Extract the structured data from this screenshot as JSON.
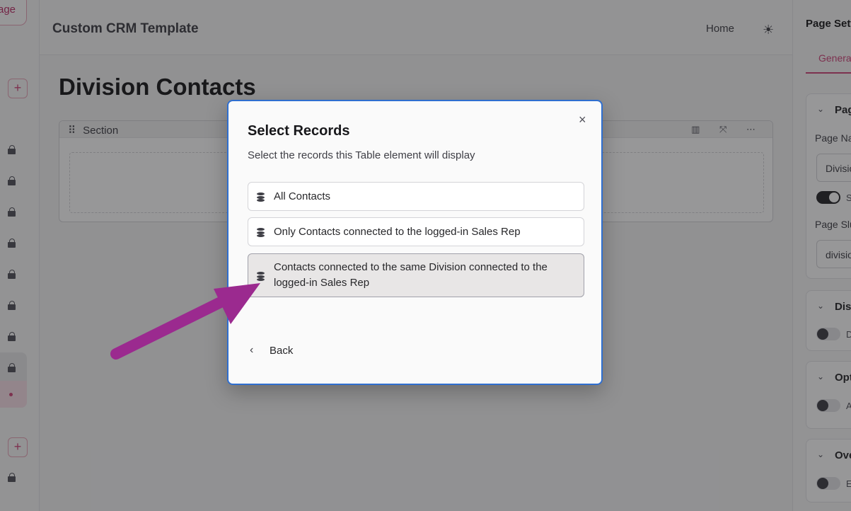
{
  "left_rail": {
    "page_chip_text": "age",
    "plus_label": "+"
  },
  "topbar": {
    "app_title": "Custom CRM Template",
    "home_label": "Home",
    "theme_icon": "☀"
  },
  "main": {
    "page_heading": "Division Contacts",
    "section_label": "Section",
    "section_drag_icon": "⠿",
    "section_tools": "▥ ⤧ ⋯"
  },
  "right_panel": {
    "title": "Page Settings",
    "tab_general": "General",
    "card1_title": "Page",
    "page_name_label": "Page Name",
    "page_name_value": "Division Contacts",
    "toggle1_text": "S",
    "page_slug_label": "Page Slug",
    "page_slug_value": "division-contacts",
    "card2_title": "Display",
    "card2_toggle_text": "D",
    "card3_title": "Options",
    "card3_toggle_text": "A",
    "card4_title": "Overview",
    "card4_toggle_text": "E",
    "chevron": "⌄"
  },
  "modal": {
    "close_icon": "×",
    "title": "Select Records",
    "description": "Select the records this Table element will display",
    "options": [
      {
        "label": "All Contacts",
        "selected": false
      },
      {
        "label": "Only Contacts connected to the logged-in Sales Rep",
        "selected": false
      },
      {
        "label": "Contacts connected to the same Division connected to the logged-in Sales Rep",
        "selected": true
      }
    ],
    "back_icon": "‹",
    "back_label": "Back"
  },
  "colors": {
    "accent": "#d0457a",
    "modal_border": "#2f6fd0",
    "annotation_arrow": "#9b2a8f"
  }
}
